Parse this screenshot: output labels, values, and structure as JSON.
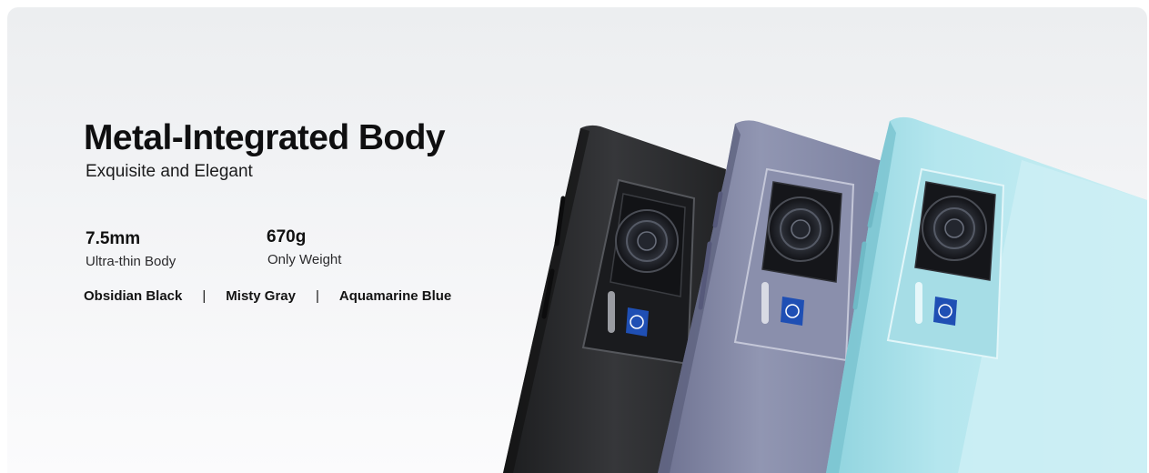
{
  "hero": {
    "title": "Metal-Integrated Body",
    "subtitle": "Exquisite and Elegant"
  },
  "specs": [
    {
      "value": "7.5mm",
      "label": "Ultra-thin Body"
    },
    {
      "value": "670g",
      "label": "Only Weight"
    }
  ],
  "color_options": [
    "Obsidian Black",
    "Misty Gray",
    "Aquamarine Blue"
  ],
  "separator": "|",
  "product_colors": {
    "obsidian_black": "#2b2c2e",
    "misty_gray": "#8e93ad",
    "aquamarine_blue": "#a8dfe8",
    "badge_blue": "#1f4fb4"
  }
}
